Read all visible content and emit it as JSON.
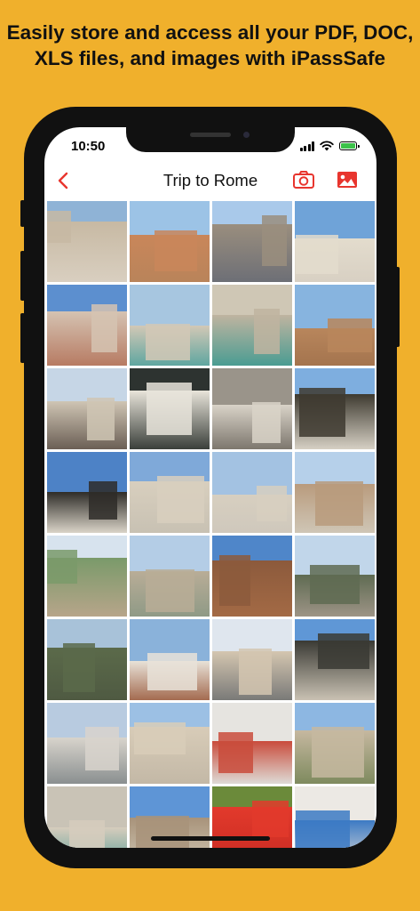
{
  "headline": {
    "line1": "Easily store and access all your PDF, DOC,",
    "line2": "XLS files, and images with iPassSafe"
  },
  "status_bar": {
    "time": "10:50",
    "icons": [
      "cellular-signal-icon",
      "wifi-icon",
      "battery-charging-icon"
    ]
  },
  "nav": {
    "title": "Trip to Rome",
    "back_icon": "chevron-left-icon",
    "camera_icon": "camera-icon",
    "gallery_icon": "image-icon",
    "accent_color": "#E8352E"
  },
  "photos": [
    {
      "name": "photo-baroque-palace",
      "sky": "#8fb3d6",
      "land": "#d9cfc0",
      "obj": "#c7b9a3"
    },
    {
      "name": "photo-orange-street",
      "sky": "#9cc3e6",
      "land": "#b9845a",
      "obj": "#c9865a"
    },
    {
      "name": "photo-narrow-street-car",
      "sky": "#a9c9ea",
      "land": "#6d6f76",
      "obj": "#9a8e7e"
    },
    {
      "name": "photo-trinita-church",
      "sky": "#6fa3d8",
      "land": "#d8d0c3",
      "obj": "#e3dccd"
    },
    {
      "name": "photo-spanish-steps",
      "sky": "#5c8fcf",
      "land": "#b77b63",
      "obj": "#d5c3b2"
    },
    {
      "name": "photo-trevi-fountain",
      "sky": "#a7c6e0",
      "land": "#5fa6a0",
      "obj": "#d2c8b6"
    },
    {
      "name": "photo-trevi-pool",
      "sky": "#cfc7b5",
      "land": "#4a9c92",
      "obj": "#bfb4a0"
    },
    {
      "name": "photo-ancient-ruins",
      "sky": "#87b4df",
      "land": "#a4744e",
      "obj": "#b8865c"
    },
    {
      "name": "photo-pantheon",
      "sky": "#c6d6e6",
      "land": "#6b5f55",
      "obj": "#cfc5b4"
    },
    {
      "name": "photo-info-sign",
      "sky": "#2d3330",
      "land": "#3a3f3a",
      "obj": "#e8e4da"
    },
    {
      "name": "photo-marble-statue",
      "sky": "#9a948a",
      "land": "#7d776e",
      "obj": "#d9d3c8"
    },
    {
      "name": "photo-equestrian-statue",
      "sky": "#7eaedf",
      "land": "#d6d0c4",
      "obj": "#3e3a30"
    },
    {
      "name": "photo-quadriga",
      "sky": "#4d82c6",
      "land": "#dad4c8",
      "obj": "#2e2c28"
    },
    {
      "name": "photo-st-peters-basilica",
      "sky": "#7fa9d9",
      "land": "#c8c1b3",
      "obj": "#d8cfbe"
    },
    {
      "name": "photo-st-peters-square",
      "sky": "#a3c2e2",
      "land": "#cfc8bc",
      "obj": "#d7cfc0"
    },
    {
      "name": "photo-castel-santangelo",
      "sky": "#b6d0ea",
      "land": "#cfc6b6",
      "obj": "#b99b7d"
    },
    {
      "name": "photo-tiber-river",
      "sky": "#d7e3ee",
      "land": "#b7a58a",
      "obj": "#7a9a6a"
    },
    {
      "name": "photo-ponte-bridge",
      "sky": "#b4cde6",
      "land": "#8f9a86",
      "obj": "#b9ad97"
    },
    {
      "name": "photo-castle-wall",
      "sky": "#4f86c9",
      "land": "#a36a45",
      "obj": "#8c5a3c"
    },
    {
      "name": "photo-bridge-crowd",
      "sky": "#c1d6ea",
      "land": "#9d9486",
      "obj": "#5f6b52"
    },
    {
      "name": "photo-willow-branches",
      "sky": "#a8c2d9",
      "land": "#4f5a42",
      "obj": "#5b6a4a"
    },
    {
      "name": "photo-seagull-roof",
      "sky": "#8ab2da",
      "land": "#a46b50",
      "obj": "#e8e2d8"
    },
    {
      "name": "photo-church-street",
      "sky": "#dfe6ee",
      "land": "#7a7a78",
      "obj": "#d4c6b0"
    },
    {
      "name": "photo-angel-statue",
      "sky": "#5f97d6",
      "land": "#c9c1b3",
      "obj": "#3a3a34"
    },
    {
      "name": "photo-vittoriano",
      "sky": "#b8cbe0",
      "land": "#8a8f90",
      "obj": "#d8d4cc"
    },
    {
      "name": "photo-trajan-column",
      "sky": "#9cc0e4",
      "land": "#c3b8a6",
      "obj": "#d8ccb8"
    },
    {
      "name": "photo-metro-map",
      "sky": "#e6e4e0",
      "land": "#dedbd6",
      "obj": "#c94c3c"
    },
    {
      "name": "photo-river-view",
      "sky": "#8db7e2",
      "land": "#7e8a5e",
      "obj": "#c6b8a0"
    },
    {
      "name": "photo-fountain-sculpture",
      "sky": "#c9c3b6",
      "land": "#5d9e98",
      "obj": "#d6cdbd"
    },
    {
      "name": "photo-obelisk",
      "sky": "#5e95d6",
      "land": "#cfc6b4",
      "obj": "#a8937a"
    },
    {
      "name": "photo-strawberries",
      "sky": "#6b8a3a",
      "land": "#c82a22",
      "obj": "#e23a2c"
    },
    {
      "name": "photo-metro-map-2",
      "sky": "#ece9e4",
      "land": "#e0ddd8",
      "obj": "#3c7ac4"
    }
  ]
}
